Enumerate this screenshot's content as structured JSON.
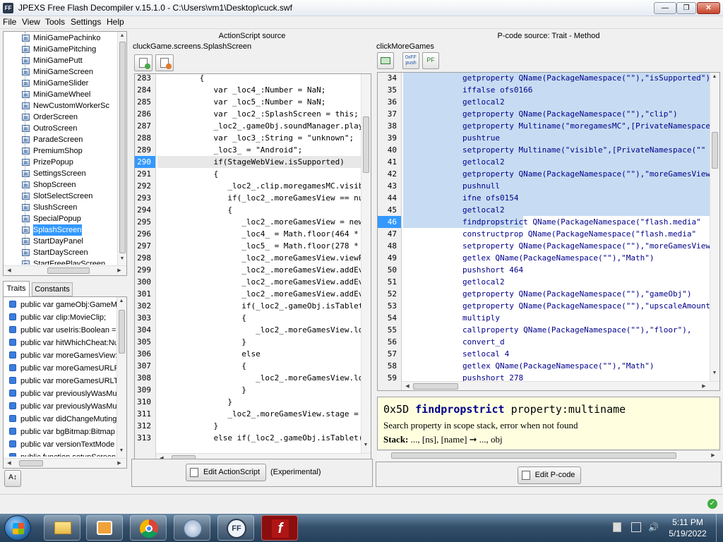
{
  "window": {
    "icon_text": "FF",
    "title": "JPEXS Free Flash Decompiler v.15.1.0 - C:\\Users\\vm1\\Desktop\\cuck.swf",
    "controls": [
      "—",
      "❐",
      "✕"
    ]
  },
  "menu": [
    "File",
    "View",
    "Tools",
    "Settings",
    "Help"
  ],
  "tree": {
    "items": [
      "MiniGamePachinko",
      "MiniGamePitching",
      "MiniGamePutt",
      "MiniGameScreen",
      "MiniGameSlider",
      "MiniGameWheel",
      "NewCustomWorkerSc",
      "OrderScreen",
      "OutroScreen",
      "ParadeScreen",
      "PremiumShop",
      "PrizePopup",
      "SettingsScreen",
      "ShopScreen",
      "SlotSelectScreen",
      "SlushScreen",
      "SpecialPopup",
      "SplashScreen",
      "StartDayPanel",
      "StartDayScreen",
      "StartFreePlayScreen"
    ],
    "selected": "SplashScreen"
  },
  "traits_panel": {
    "tabs": [
      "Traits",
      "Constants"
    ],
    "items": [
      "public var gameObj:GameMc",
      "public var clip:MovieClip;",
      "public var useIris:Boolean =",
      "public var hitWhichCheat:Nu",
      "public var moreGamesView:S",
      "public var moreGamesURLPh",
      "public var moreGamesURLTa",
      "public var previouslyWasMu",
      "public var previouslyWasMu",
      "public var didChangeMuting",
      "public var bgBitmap:Bitmap",
      "public var versionTextMode",
      "public function setupScreen"
    ]
  },
  "as_panel": {
    "header": "ActionScript source",
    "breadcrumb": "cluckGame.screens.SplashScreen",
    "lines": [
      {
        "n": "283",
        "t": "         {"
      },
      {
        "n": "284",
        "t": "            var _loc4_:Number = NaN;"
      },
      {
        "n": "285",
        "t": "            var _loc5_:Number = NaN;"
      },
      {
        "n": "286",
        "t": "            var _loc2_:SplashScreen = this;"
      },
      {
        "n": "287",
        "t": "            _loc2_.gameObj.soundManager.play"
      },
      {
        "n": "288",
        "t": "            var _loc3_:String = \"unknown\";"
      },
      {
        "n": "289",
        "t": "            _loc3_ = \"Android\";"
      },
      {
        "n": "290",
        "t": "            if(StageWebView.isSupported)"
      },
      {
        "n": "291",
        "t": "            {"
      },
      {
        "n": "292",
        "t": "               _loc2_.clip.moregamesMC.visib"
      },
      {
        "n": "293",
        "t": "               if(_loc2_.moreGamesView == nu"
      },
      {
        "n": "294",
        "t": "               {"
      },
      {
        "n": "295",
        "t": "                  _loc2_.moreGamesView = new"
      },
      {
        "n": "296",
        "t": "                  _loc4_ = Math.floor(464 *"
      },
      {
        "n": "297",
        "t": "                  _loc5_ = Math.floor(278 *"
      },
      {
        "n": "298",
        "t": "                  _loc2_.moreGamesView.viewP"
      },
      {
        "n": "299",
        "t": "                  _loc2_.moreGamesView.addEv"
      },
      {
        "n": "300",
        "t": "                  _loc2_.moreGamesView.addEv"
      },
      {
        "n": "301",
        "t": "                  _loc2_.moreGamesView.addEv"
      },
      {
        "n": "302",
        "t": "                  if(_loc2_.gameObj.isTablet"
      },
      {
        "n": "303",
        "t": "                  {"
      },
      {
        "n": "304",
        "t": "                     _loc2_.moreGamesView.lo"
      },
      {
        "n": "305",
        "t": "                  }"
      },
      {
        "n": "306",
        "t": "                  else"
      },
      {
        "n": "307",
        "t": "                  {"
      },
      {
        "n": "308",
        "t": "                     _loc2_.moreGamesView.lo"
      },
      {
        "n": "309",
        "t": "                  }"
      },
      {
        "n": "310",
        "t": "               }"
      },
      {
        "n": "311",
        "t": "               _loc2_.moreGamesView.stage ="
      },
      {
        "n": "312",
        "t": "            }"
      },
      {
        "n": "313",
        "t": "            else if(_loc2_.gameObj.isTablet("
      }
    ],
    "current_line": "290",
    "edit_button": "Edit ActionScript",
    "experimental": "(Experimental)"
  },
  "pcode_panel": {
    "header": "P-code source: Trait - Method",
    "breadcrumb": "clickMoreGames",
    "toolbar_labels": [
      "0xFF\npush",
      "PF"
    ],
    "lines": [
      {
        "n": "34",
        "t": "getproperty QName(PackageNamespace(\"\"),\"isSupported\")"
      },
      {
        "n": "35",
        "t": "iffalse ofs0166"
      },
      {
        "n": "36",
        "t": "getlocal2"
      },
      {
        "n": "37",
        "t": "getproperty QName(PackageNamespace(\"\"),\"clip\")"
      },
      {
        "n": "38",
        "t": "getproperty Multiname(\"moregamesMC\",[PrivateNamespace"
      },
      {
        "n": "39",
        "t": "pushtrue"
      },
      {
        "n": "40",
        "t": "setproperty Multiname(\"visible\",[PrivateNamespace(\"\""
      },
      {
        "n": "41",
        "t": "getlocal2"
      },
      {
        "n": "42",
        "t": "getproperty QName(PackageNamespace(\"\"),\"moreGamesView\""
      },
      {
        "n": "43",
        "t": "pushnull"
      },
      {
        "n": "44",
        "t": "ifne ofs0154"
      },
      {
        "n": "45",
        "t": "getlocal2"
      },
      {
        "n": "46",
        "t": "findpropstrict QName(PackageNamespace(\"flash.media\""
      },
      {
        "n": "47",
        "t": "constructprop QName(PackageNamespace(\"flash.media\""
      },
      {
        "n": "48",
        "t": "setproperty QName(PackageNamespace(\"\"),\"moreGamesView\""
      },
      {
        "n": "49",
        "t": "getlex QName(PackageNamespace(\"\"),\"Math\")"
      },
      {
        "n": "50",
        "t": "pushshort 464"
      },
      {
        "n": "51",
        "t": "getlocal2"
      },
      {
        "n": "52",
        "t": "getproperty QName(PackageNamespace(\"\"),\"gameObj\")"
      },
      {
        "n": "53",
        "t": "getproperty QName(PackageNamespace(\"\"),\"upscaleAmount\""
      },
      {
        "n": "54",
        "t": "multiply"
      },
      {
        "n": "55",
        "t": "callproperty QName(PackageNamespace(\"\"),\"floor\"),"
      },
      {
        "n": "56",
        "t": "convert_d"
      },
      {
        "n": "57",
        "t": "setlocal 4"
      },
      {
        "n": "58",
        "t": "getlex QName(PackageNamespace(\"\"),\"Math\")"
      },
      {
        "n": "59",
        "t": "pushshort 278"
      }
    ],
    "current_line": "46",
    "selected_range": [
      "34",
      "46"
    ],
    "edit_button": "Edit P-code"
  },
  "docs": {
    "opcode": "0x5D",
    "name": "findpropstrict",
    "operands": "property:multiname",
    "description": "Search property in scope stack, error when not found",
    "stack_label": "Stack:",
    "stack_value": "..., [ns], [name] ➞ ..., obj"
  },
  "taskbar": {
    "time": "5:11 PM",
    "date": "5/19/2022",
    "apps": [
      "explorer-icon",
      "media-player-icon",
      "chrome-icon",
      "downloader-icon",
      "ffdec-icon",
      "flash-icon"
    ]
  },
  "colors": {
    "selection": "#3399ff",
    "code_selection": "#c7dcf2",
    "current_line": "#cde3f7",
    "docs_bg": "#ffffe0",
    "keyword": "#0000cc",
    "string": "#cc7700"
  }
}
